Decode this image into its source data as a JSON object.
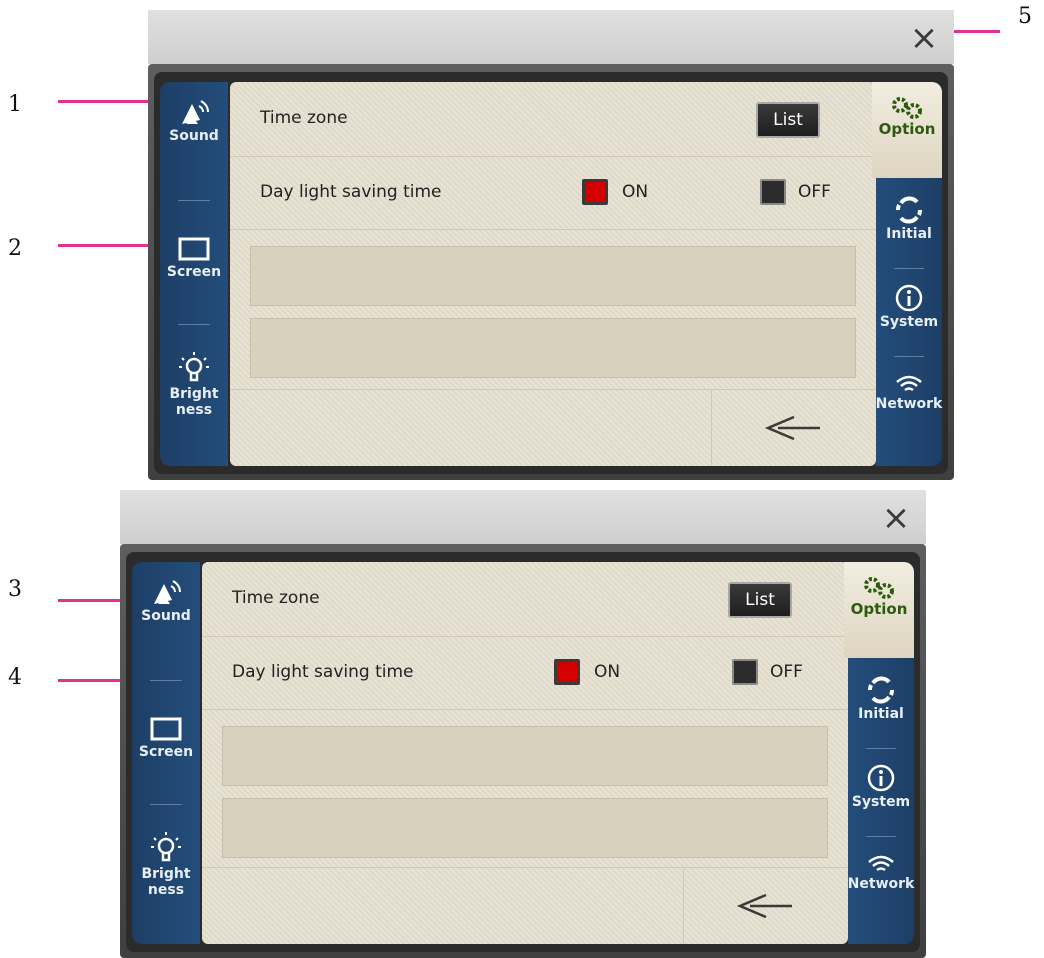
{
  "callouts": [
    "1",
    "2",
    "3",
    "4",
    "5"
  ],
  "panels": [
    {
      "close_icon": "×",
      "left_nav": [
        {
          "label": "Sound",
          "icon": "speaker-icon"
        },
        {
          "label": "Screen",
          "icon": "screen-icon"
        },
        {
          "label": "Bright\nness",
          "icon": "bulb-icon"
        }
      ],
      "right_nav": [
        {
          "label": "Option",
          "icon": "gears-icon",
          "active": true
        },
        {
          "label": "Initial",
          "icon": "refresh-icon"
        },
        {
          "label": "System",
          "icon": "info-icon"
        },
        {
          "label": "Network",
          "icon": "wifi-icon"
        }
      ],
      "time_zone_label": "Time zone",
      "list_button": "List",
      "dst_label": "Day light saving time",
      "on_label": "ON",
      "off_label": "OFF",
      "dst_value": "ON",
      "back_icon": "back-arrow-icon"
    },
    {
      "close_icon": "×",
      "left_nav": [
        {
          "label": "Sound",
          "icon": "speaker-icon"
        },
        {
          "label": "Screen",
          "icon": "screen-icon"
        },
        {
          "label": "Bright\nness",
          "icon": "bulb-icon"
        }
      ],
      "right_nav": [
        {
          "label": "Option",
          "icon": "gears-icon",
          "active": true
        },
        {
          "label": "Initial",
          "icon": "refresh-icon"
        },
        {
          "label": "System",
          "icon": "info-icon"
        },
        {
          "label": "Network",
          "icon": "wifi-icon"
        }
      ],
      "time_zone_label": "Time zone",
      "list_button": "List",
      "dst_label": "Day light saving time",
      "on_label": "ON",
      "off_label": "OFF",
      "dst_value": "ON",
      "back_icon": "back-arrow-icon"
    }
  ],
  "colors": {
    "accent_pink": "#e0338f",
    "nav_blue": "#1d3f66",
    "on_red": "#d40000",
    "option_green": "#2e5a10"
  }
}
